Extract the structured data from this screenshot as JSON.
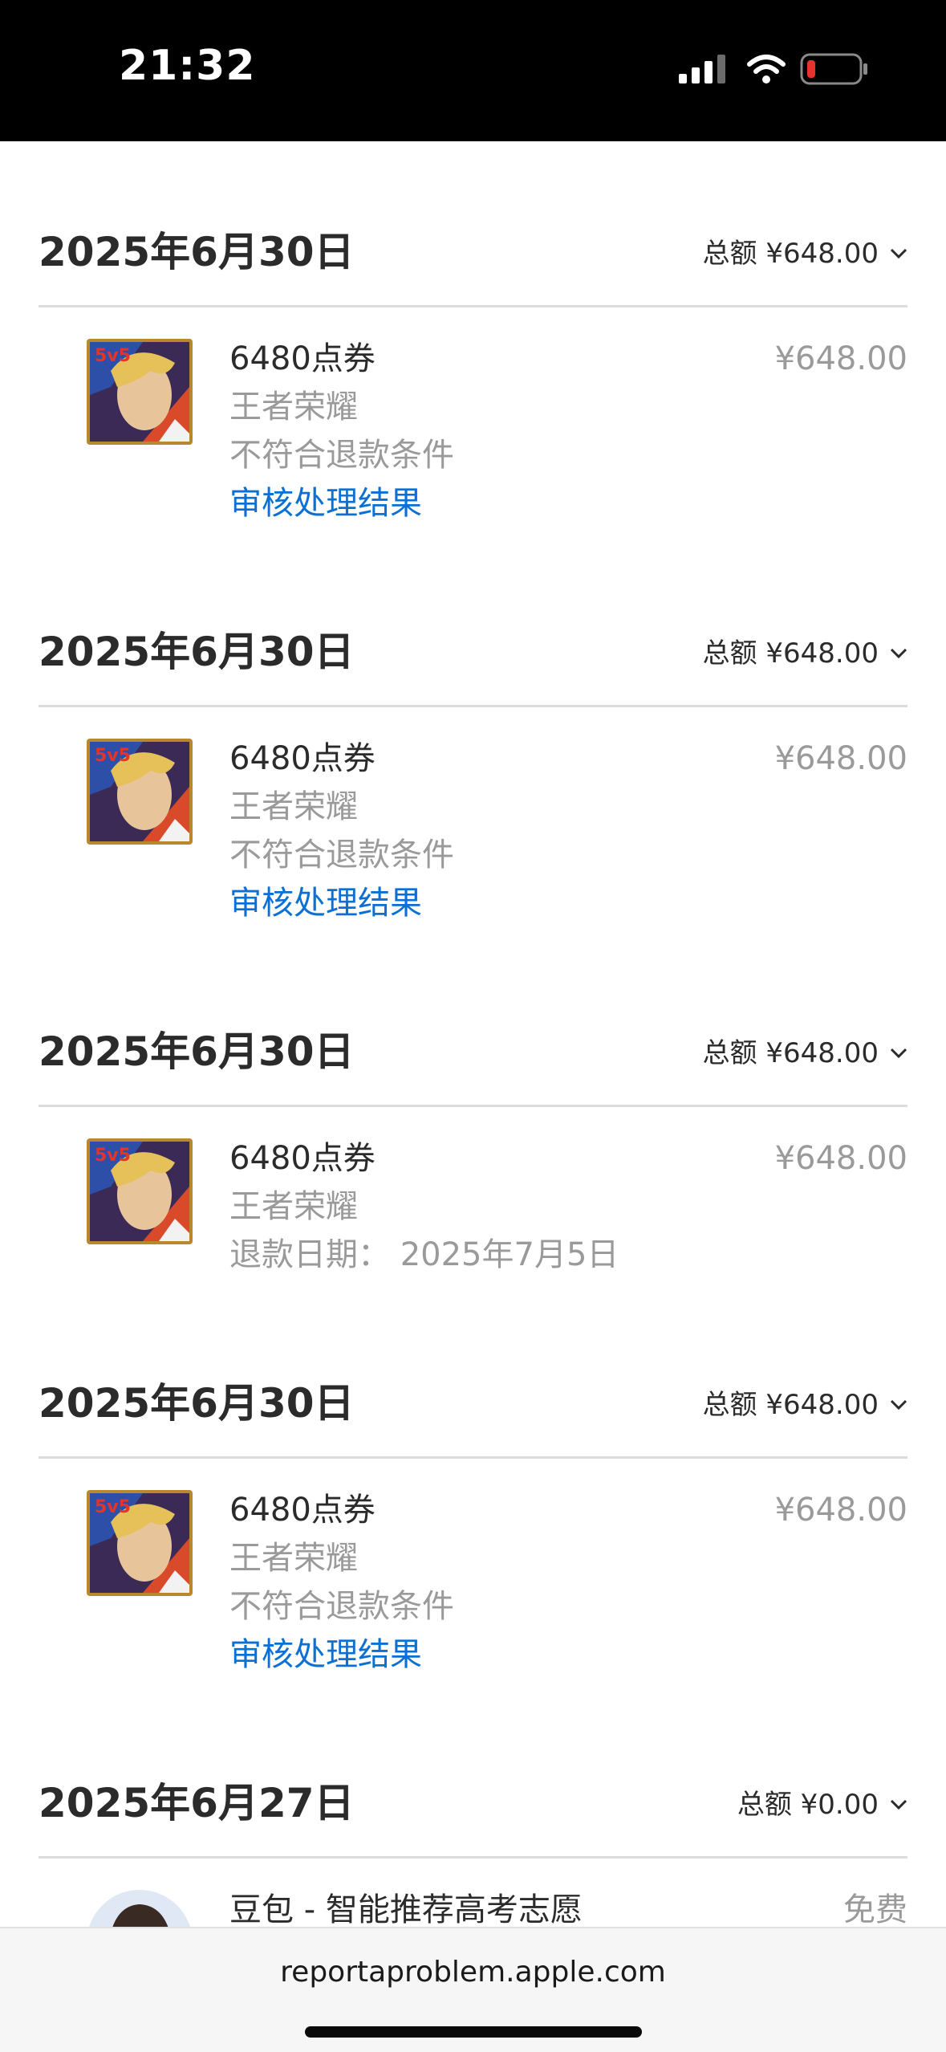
{
  "status_bar": {
    "time": "21:32",
    "battery_color": "#e8322e"
  },
  "orders": [
    {
      "date": "2025年6月30日",
      "total": "总额 ¥648.00",
      "item": {
        "title": "6480点券",
        "price": "¥648.00",
        "app": "王者荣耀",
        "status": "不符合退款条件",
        "link": "审核处理结果"
      }
    },
    {
      "date": "2025年6月30日",
      "total": "总额 ¥648.00",
      "item": {
        "title": "6480点券",
        "price": "¥648.00",
        "app": "王者荣耀",
        "status": "不符合退款条件",
        "link": "审核处理结果"
      }
    },
    {
      "date": "2025年6月30日",
      "total": "总额 ¥648.00",
      "item": {
        "title": "6480点券",
        "price": "¥648.00",
        "app": "王者荣耀",
        "status": "退款日期： 2025年7月5日"
      }
    },
    {
      "date": "2025年6月30日",
      "total": "总额 ¥648.00",
      "item": {
        "title": "6480点券",
        "price": "¥648.00",
        "app": "王者荣耀",
        "status": "不符合退款条件",
        "link": "审核处理结果"
      }
    },
    {
      "date": "2025年6月27日",
      "total": "总额 ¥0.00",
      "item": {
        "title": "豆包 - 智能推荐高考志愿",
        "price": "免费"
      }
    }
  ],
  "game_icon_label": "5v5",
  "url": "reportaproblem.apple.com",
  "colors": {
    "link": "#0b6fd3",
    "secondary_text": "#9a9a9a",
    "primary_text": "#2b2b2b"
  }
}
